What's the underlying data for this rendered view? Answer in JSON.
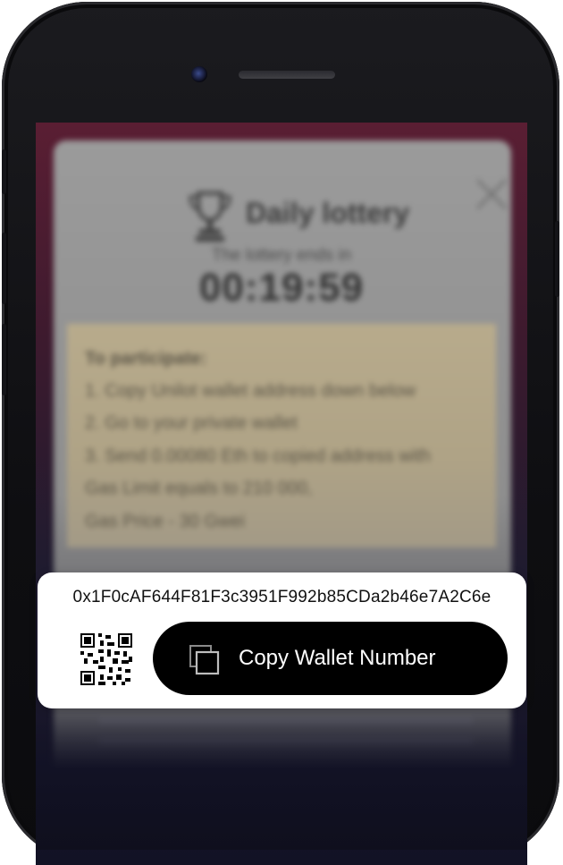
{
  "lottery": {
    "title": "Daily lottery",
    "ends_label": "The lottery ends in",
    "timer": "00:19:59",
    "instructions": {
      "heading": "To participate:",
      "step1": "1. Copy Unilot wallet address down below",
      "step2": "2. Go to your private wallet",
      "step3": "3. Send 0.00080 Eth to copied address with",
      "gas_limit": "Gas Limit equals to 210 000,",
      "gas_price": "Gas Price - 30 Gwei"
    }
  },
  "wallet": {
    "address": "0x1F0cAF644F81F3c3951F992b85CDa2b46e7A2C6e",
    "copy_button_label": "Copy Wallet Number",
    "icons": {
      "qr": "qr-code-icon",
      "copy": "copy-icon",
      "close": "close-icon",
      "trophy": "trophy-icon"
    }
  },
  "colors": {
    "button_bg": "#000000",
    "button_text": "#ffffff",
    "card_bg": "#ffffff",
    "instructions_bg": "#b8ab8c"
  }
}
